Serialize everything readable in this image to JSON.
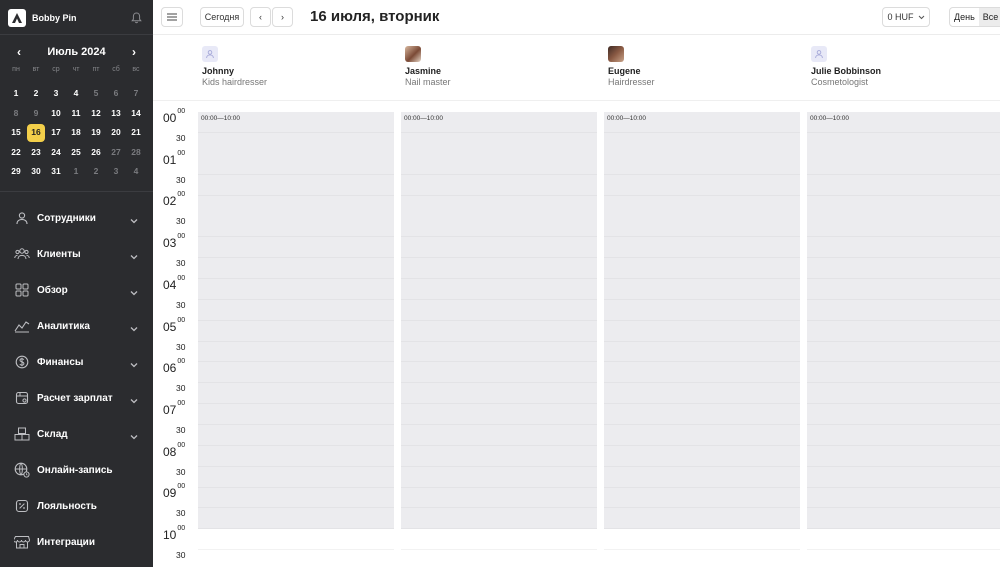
{
  "brand": {
    "name": "Bobby Pin"
  },
  "calendar": {
    "month_label": "Июль 2024",
    "weekdays": [
      "пн",
      "вт",
      "ср",
      "чт",
      "пт",
      "сб",
      "вс"
    ],
    "days": [
      {
        "d": "1",
        "m": false
      },
      {
        "d": "2",
        "m": false
      },
      {
        "d": "3",
        "m": false
      },
      {
        "d": "4",
        "m": false
      },
      {
        "d": "5",
        "m": true
      },
      {
        "d": "6",
        "m": true
      },
      {
        "d": "7",
        "m": true
      },
      {
        "d": "8",
        "m": true
      },
      {
        "d": "9",
        "m": true
      },
      {
        "d": "10",
        "m": false
      },
      {
        "d": "11",
        "m": false
      },
      {
        "d": "12",
        "m": false
      },
      {
        "d": "13",
        "m": false
      },
      {
        "d": "14",
        "m": false
      },
      {
        "d": "15",
        "m": false
      },
      {
        "d": "16",
        "m": false,
        "today": true
      },
      {
        "d": "17",
        "m": false
      },
      {
        "d": "18",
        "m": false
      },
      {
        "d": "19",
        "m": false
      },
      {
        "d": "20",
        "m": false
      },
      {
        "d": "21",
        "m": false
      },
      {
        "d": "22",
        "m": false
      },
      {
        "d": "23",
        "m": false
      },
      {
        "d": "24",
        "m": false
      },
      {
        "d": "25",
        "m": false
      },
      {
        "d": "26",
        "m": false
      },
      {
        "d": "27",
        "m": true
      },
      {
        "d": "28",
        "m": true
      },
      {
        "d": "29",
        "m": false
      },
      {
        "d": "30",
        "m": false
      },
      {
        "d": "31",
        "m": false
      },
      {
        "d": "1",
        "m": true
      },
      {
        "d": "2",
        "m": true
      },
      {
        "d": "3",
        "m": true
      },
      {
        "d": "4",
        "m": true
      }
    ]
  },
  "nav": [
    {
      "label": "Сотрудники",
      "icon": "person-icon",
      "chevron": true
    },
    {
      "label": "Клиенты",
      "icon": "clients-icon",
      "chevron": true
    },
    {
      "label": "Обзор",
      "icon": "overview-icon",
      "chevron": true
    },
    {
      "label": "Аналитика",
      "icon": "analytics-icon",
      "chevron": true
    },
    {
      "label": "Финансы",
      "icon": "finance-icon",
      "chevron": true
    },
    {
      "label": "Расчет зарплат",
      "icon": "payroll-icon",
      "chevron": true
    },
    {
      "label": "Склад",
      "icon": "warehouse-icon",
      "chevron": true
    },
    {
      "label": "Онлайн-запись",
      "icon": "globe-icon",
      "chevron": false
    },
    {
      "label": "Лояльность",
      "icon": "loyalty-icon",
      "chevron": false
    },
    {
      "label": "Интеграции",
      "icon": "store-icon",
      "chevron": false
    }
  ],
  "header": {
    "today_label": "Сегодня",
    "date_title": "16 июля, вторник",
    "currency_label": "0 HUF",
    "view_day": "День",
    "view_all": "Все"
  },
  "staff": [
    {
      "name": "Johnny",
      "role": "Kids hairdresser",
      "avatar": "placeholder",
      "slot": "00:00—10:00"
    },
    {
      "name": "Jasmine",
      "role": "Nail master",
      "avatar": "photo",
      "slot": "00:00—10:00"
    },
    {
      "name": "Eugene",
      "role": "Hairdresser",
      "avatar": "photo",
      "slot": "00:00—10:00"
    },
    {
      "name": "Julie Bobbinson",
      "role": "Cosmetologist",
      "avatar": "placeholder",
      "slot": "00:00—10:00"
    }
  ],
  "times": {
    "hours": [
      "00",
      "01",
      "02",
      "03",
      "04",
      "05",
      "06",
      "07",
      "08",
      "09",
      "10"
    ],
    "minute_zero": "00",
    "half": "30"
  },
  "colors": {
    "sidebar_bg": "#2b2c2f",
    "today_highlight": "#f3cf4a",
    "off_hours": "#ececef"
  }
}
